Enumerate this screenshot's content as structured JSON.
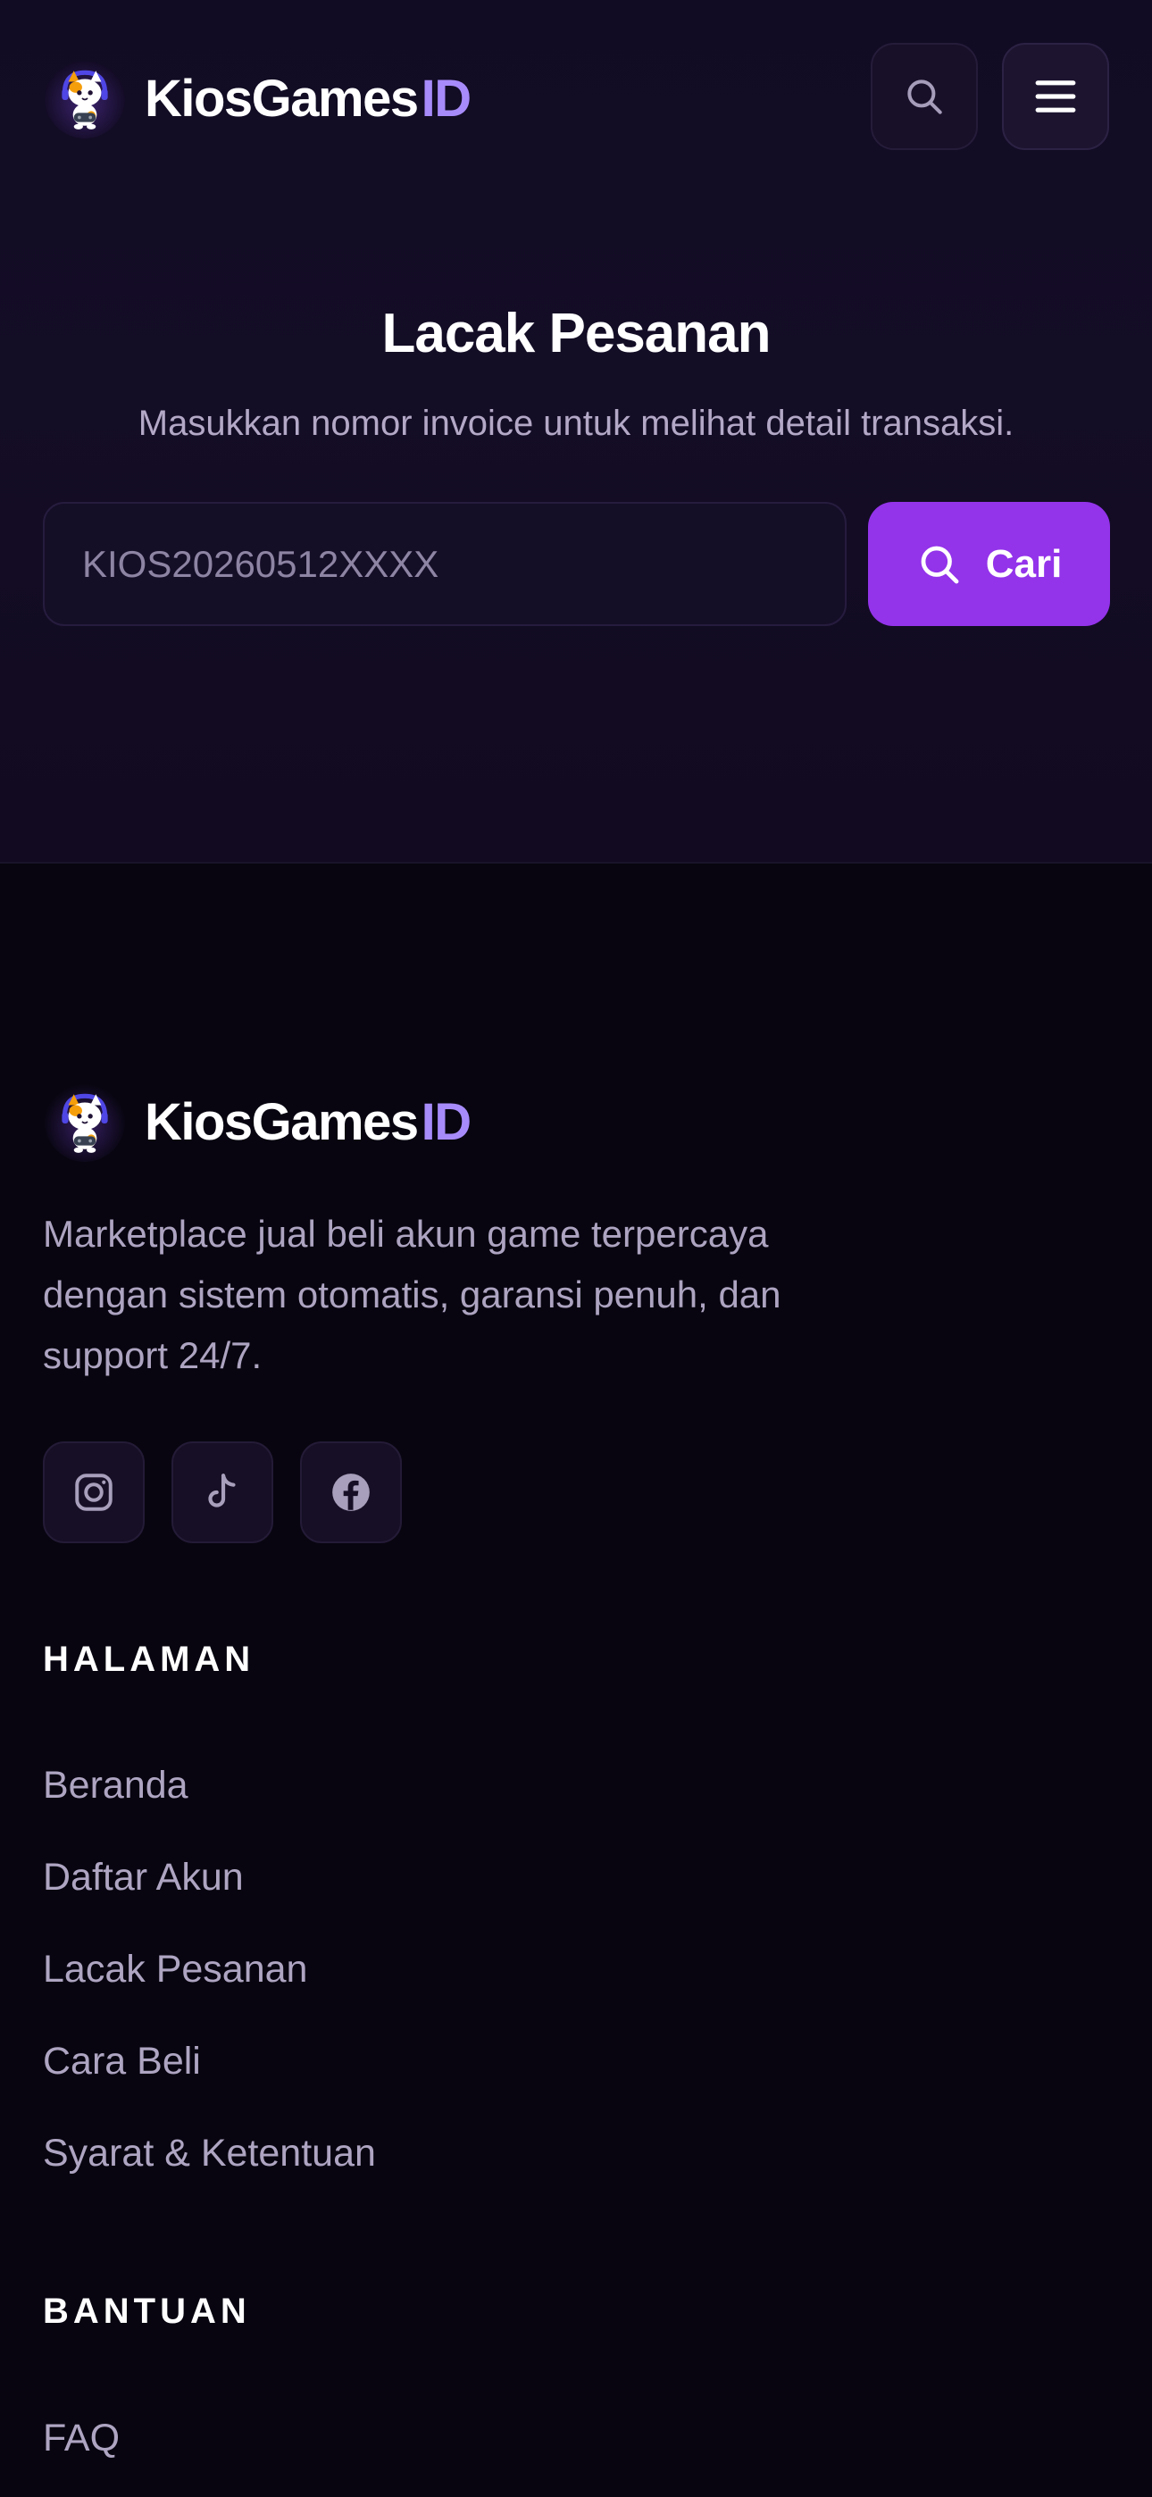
{
  "header": {
    "brand_name": "KiosGames",
    "brand_suffix": "ID",
    "logo_icon": "cat-gamer-mascot-icon",
    "search_icon": "search-icon",
    "menu_icon": "hamburger-menu-icon"
  },
  "hero": {
    "title": "Lacak Pesanan",
    "subtitle": "Masukkan nomor invoice untuk melihat detail transaksi.",
    "search_placeholder": "KIOS20260512XXXX",
    "search_value": "",
    "search_button_label": "Cari"
  },
  "footer": {
    "brand_name": "KiosGames",
    "brand_suffix": "ID",
    "description": "Marketplace jual beli akun game terpercaya dengan sistem otomatis, garansi penuh, dan support 24/7.",
    "socials": [
      {
        "icon": "instagram-icon"
      },
      {
        "icon": "tiktok-icon"
      },
      {
        "icon": "facebook-icon"
      }
    ],
    "pages_heading": "HALAMAN",
    "pages": [
      {
        "label": "Beranda"
      },
      {
        "label": "Daftar Akun"
      },
      {
        "label": "Lacak Pesanan"
      },
      {
        "label": "Cara Beli"
      },
      {
        "label": "Syarat & Ketentuan"
      }
    ],
    "help_heading": "BANTUAN",
    "help": [
      {
        "label": "FAQ"
      }
    ]
  },
  "colors": {
    "background": "#07050f",
    "hero_background": "#130c25",
    "accent": "#9333ea",
    "brand_suffix": "#a78bfa",
    "muted_text": "#ada4c1"
  }
}
